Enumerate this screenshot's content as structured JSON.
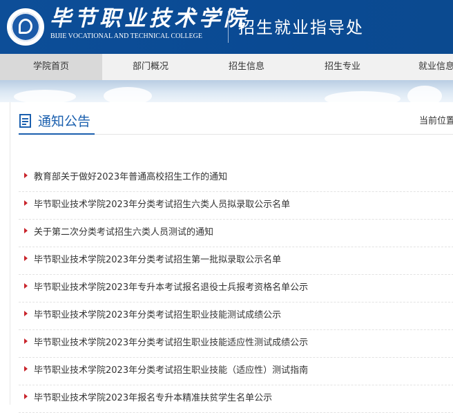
{
  "header": {
    "college_name": "毕节职业技术学院",
    "college_name_en": "BIJIE VOCATIONAL AND TECHNICAL COLLEGE",
    "office_name": "招生就业指导处",
    "logo_icon": "college-seal-icon"
  },
  "nav": {
    "items": [
      {
        "label": "学院首页",
        "active": true
      },
      {
        "label": "部门概况"
      },
      {
        "label": "招生信息"
      },
      {
        "label": "招生专业"
      },
      {
        "label": "就业信息"
      }
    ]
  },
  "section": {
    "title": "通知公告",
    "icon": "document-icon",
    "location_label": "当前位置"
  },
  "notices": [
    {
      "title": "教育部关于做好2023年普通高校招生工作的通知"
    },
    {
      "title": "毕节职业技术学院2023年分类考试招生六类人员拟录取公示名单"
    },
    {
      "title": "关于第二次分类考试招生六类人员测试的通知"
    },
    {
      "title": "毕节职业技术学院2023年分类考试招生第一批拟录取公示名单"
    },
    {
      "title": "毕节职业技术学院2023年专升本考试报名退役士兵报考资格名单公示"
    },
    {
      "title": "毕节职业技术学院2023年分类考试招生职业技能测试成绩公示"
    },
    {
      "title": "毕节职业技术学院2023年分类考试招生职业技能适应性测试成绩公示"
    },
    {
      "title": "毕节职业技术学院2023年分类考试招生职业技能（适应性）测试指南"
    },
    {
      "title": "毕节职业技术学院2023年报名专升本精准扶贫学生名单公示"
    }
  ],
  "colors": {
    "header_bg": "#0d4e98",
    "accent": "#1a5fae",
    "bullet": "#c9252c",
    "nav_bg": "#f1f1f1",
    "nav_active_bg": "#d9d9d9"
  }
}
